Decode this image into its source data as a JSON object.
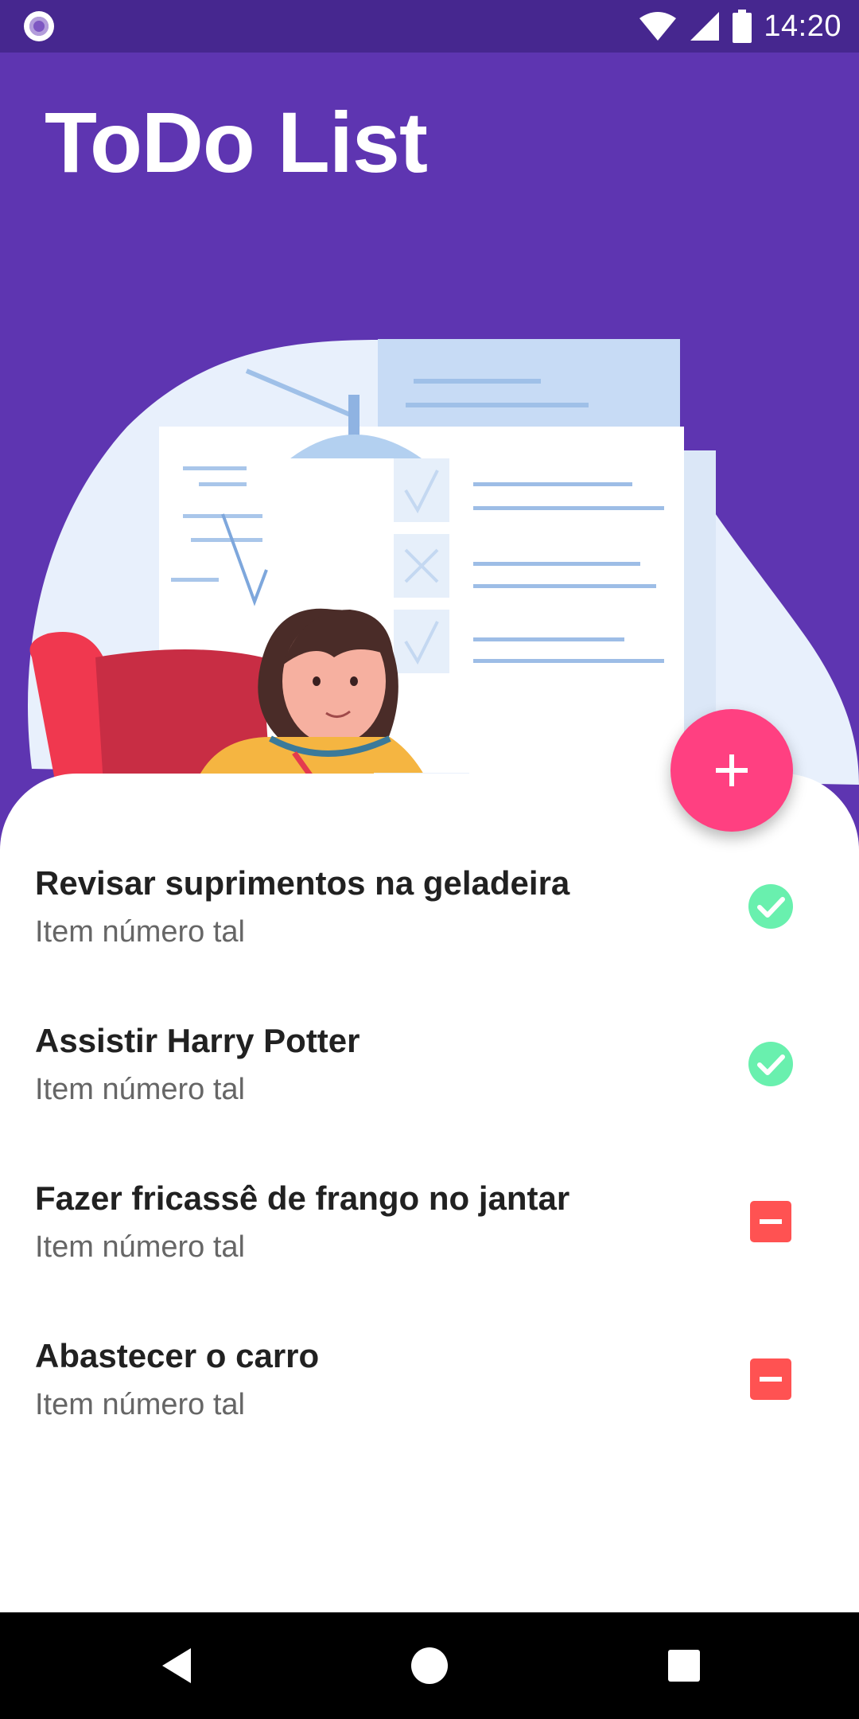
{
  "status_bar": {
    "time": "14:20",
    "icons": [
      "notification-dot-icon",
      "wifi-icon",
      "cellular-signal-icon",
      "battery-icon"
    ]
  },
  "app": {
    "title": "ToDo List"
  },
  "fab": {
    "icon": "plus-icon",
    "color": "#ff4081"
  },
  "todos": [
    {
      "title": "Revisar suprimentos na geladeira",
      "subtitle": "Item número tal",
      "status": "done",
      "icon": "check-circle-icon"
    },
    {
      "title": "Assistir Harry Potter",
      "subtitle": "Item número tal",
      "status": "done",
      "icon": "check-circle-icon"
    },
    {
      "title": "Fazer fricassê de frango no jantar",
      "subtitle": "Item número tal",
      "status": "pending",
      "icon": "minus-box-icon"
    },
    {
      "title": "Abastecer o carro",
      "subtitle": "Item número tal",
      "status": "pending",
      "icon": "minus-box-icon"
    }
  ],
  "nav_bar": {
    "buttons": [
      "back-icon",
      "home-icon",
      "recents-icon"
    ]
  },
  "colors": {
    "primary": "#5e35b1",
    "status_bar": "#46278f",
    "accent": "#ff4081",
    "done": "#69f0ae",
    "pending": "#ff5252"
  }
}
